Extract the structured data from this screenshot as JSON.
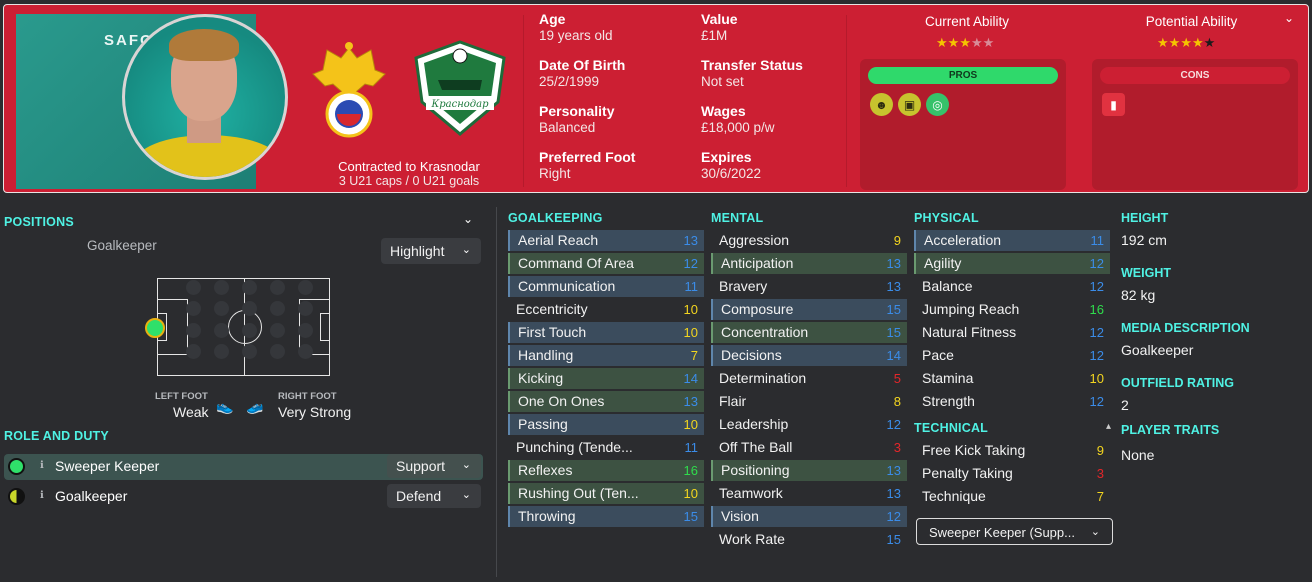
{
  "player": {
    "name": "SAFON",
    "contract_line": "Contracted to Krasnodar",
    "caps_line": "3 U21 caps / 0 U21 goals",
    "flag_icon": "russia-football-union-crest",
    "club_icon": "krasnodar-crest",
    "club_badge_text": "Краснодар"
  },
  "info": {
    "age_label": "Age",
    "age": "19 years old",
    "dob_label": "Date Of Birth",
    "dob": "25/2/1999",
    "personality_label": "Personality",
    "personality": "Balanced",
    "foot_label": "Preferred Foot",
    "foot": "Right",
    "value_label": "Value",
    "value": "£1M",
    "transfer_label": "Transfer Status",
    "transfer": "Not set",
    "wages_label": "Wages",
    "wages": "£18,000 p/w",
    "expires_label": "Expires",
    "expires": "30/6/2022"
  },
  "ability": {
    "current_label": "Current Ability",
    "current_stars": 3,
    "current_max": 5,
    "potential_label": "Potential Ability",
    "potential_stars": 4,
    "potential_max": 5
  },
  "pros": {
    "label": "PROS",
    "icons": [
      "head-icon",
      "pitch-icon",
      "target-icon"
    ]
  },
  "cons": {
    "label": "CONS",
    "icons": [
      "red-card-icon"
    ]
  },
  "positions": {
    "title": "POSITIONS",
    "position": "Goalkeeper",
    "highlight": "Highlight",
    "left_foot_label": "LEFT FOOT",
    "left_foot": "Weak",
    "right_foot_label": "RIGHT FOOT",
    "right_foot": "Very Strong"
  },
  "roles": {
    "title": "ROLE AND DUTY",
    "items": [
      {
        "name": "Sweeper Keeper",
        "duty": "Support",
        "indicator": "#2fe06a"
      },
      {
        "name": "Goalkeeper",
        "duty": "Defend",
        "indicator": "#c8d62a"
      }
    ]
  },
  "columns": {
    "goalkeeping": {
      "title": "GOALKEEPING",
      "items": [
        {
          "name": "Aerial Reach",
          "value": "13",
          "hl": "b"
        },
        {
          "name": "Command Of Area",
          "value": "12",
          "hl": "g"
        },
        {
          "name": "Communication",
          "value": "11",
          "hl": "b"
        },
        {
          "name": "Eccentricity",
          "value": "10",
          "hl": ""
        },
        {
          "name": "First Touch",
          "value": "10",
          "hl": "b"
        },
        {
          "name": "Handling",
          "value": "7",
          "hl": "b"
        },
        {
          "name": "Kicking",
          "value": "14",
          "hl": "g"
        },
        {
          "name": "One On Ones",
          "value": "13",
          "hl": "g"
        },
        {
          "name": "Passing",
          "value": "10",
          "hl": "b"
        },
        {
          "name": "Punching (Tende...",
          "value": "11",
          "hl": ""
        },
        {
          "name": "Reflexes",
          "value": "16",
          "hl": "g"
        },
        {
          "name": "Rushing Out (Ten...",
          "value": "10",
          "hl": "g"
        },
        {
          "name": "Throwing",
          "value": "15",
          "hl": "b"
        }
      ]
    },
    "mental": {
      "title": "MENTAL",
      "items": [
        {
          "name": "Aggression",
          "value": "9",
          "hl": ""
        },
        {
          "name": "Anticipation",
          "value": "13",
          "hl": "g"
        },
        {
          "name": "Bravery",
          "value": "13",
          "hl": ""
        },
        {
          "name": "Composure",
          "value": "15",
          "hl": "b"
        },
        {
          "name": "Concentration",
          "value": "15",
          "hl": "g"
        },
        {
          "name": "Decisions",
          "value": "14",
          "hl": "b"
        },
        {
          "name": "Determination",
          "value": "5",
          "hl": ""
        },
        {
          "name": "Flair",
          "value": "8",
          "hl": ""
        },
        {
          "name": "Leadership",
          "value": "12",
          "hl": ""
        },
        {
          "name": "Off The Ball",
          "value": "3",
          "hl": ""
        },
        {
          "name": "Positioning",
          "value": "13",
          "hl": "g"
        },
        {
          "name": "Teamwork",
          "value": "13",
          "hl": ""
        },
        {
          "name": "Vision",
          "value": "12",
          "hl": "b"
        },
        {
          "name": "Work Rate",
          "value": "15",
          "hl": ""
        }
      ]
    },
    "physical": {
      "title": "PHYSICAL",
      "items": [
        {
          "name": "Acceleration",
          "value": "11",
          "hl": "b"
        },
        {
          "name": "Agility",
          "value": "12",
          "hl": "g"
        },
        {
          "name": "Balance",
          "value": "12",
          "hl": ""
        },
        {
          "name": "Jumping Reach",
          "value": "16",
          "hl": ""
        },
        {
          "name": "Natural Fitness",
          "value": "12",
          "hl": ""
        },
        {
          "name": "Pace",
          "value": "12",
          "hl": ""
        },
        {
          "name": "Stamina",
          "value": "10",
          "hl": ""
        },
        {
          "name": "Strength",
          "value": "12",
          "hl": ""
        }
      ]
    },
    "technical": {
      "title": "TECHNICAL",
      "items": [
        {
          "name": "Free Kick Taking",
          "value": "9",
          "hl": ""
        },
        {
          "name": "Penalty Taking",
          "value": "3",
          "hl": ""
        },
        {
          "name": "Technique",
          "value": "7",
          "hl": ""
        }
      ]
    },
    "role_select": "Sweeper Keeper (Supp..."
  },
  "details": {
    "height_label": "HEIGHT",
    "height": "192 cm",
    "weight_label": "WEIGHT",
    "weight": "82 kg",
    "media_label": "MEDIA DESCRIPTION",
    "media": "Goalkeeper",
    "outfield_label": "OUTFIELD RATING",
    "outfield": "2",
    "traits_label": "PLAYER TRAITS",
    "traits": "None"
  },
  "colors": {
    "header_red": "#cc1f33",
    "accent_teal": "#4ff2e4",
    "pros_green": "#2fd96b"
  }
}
